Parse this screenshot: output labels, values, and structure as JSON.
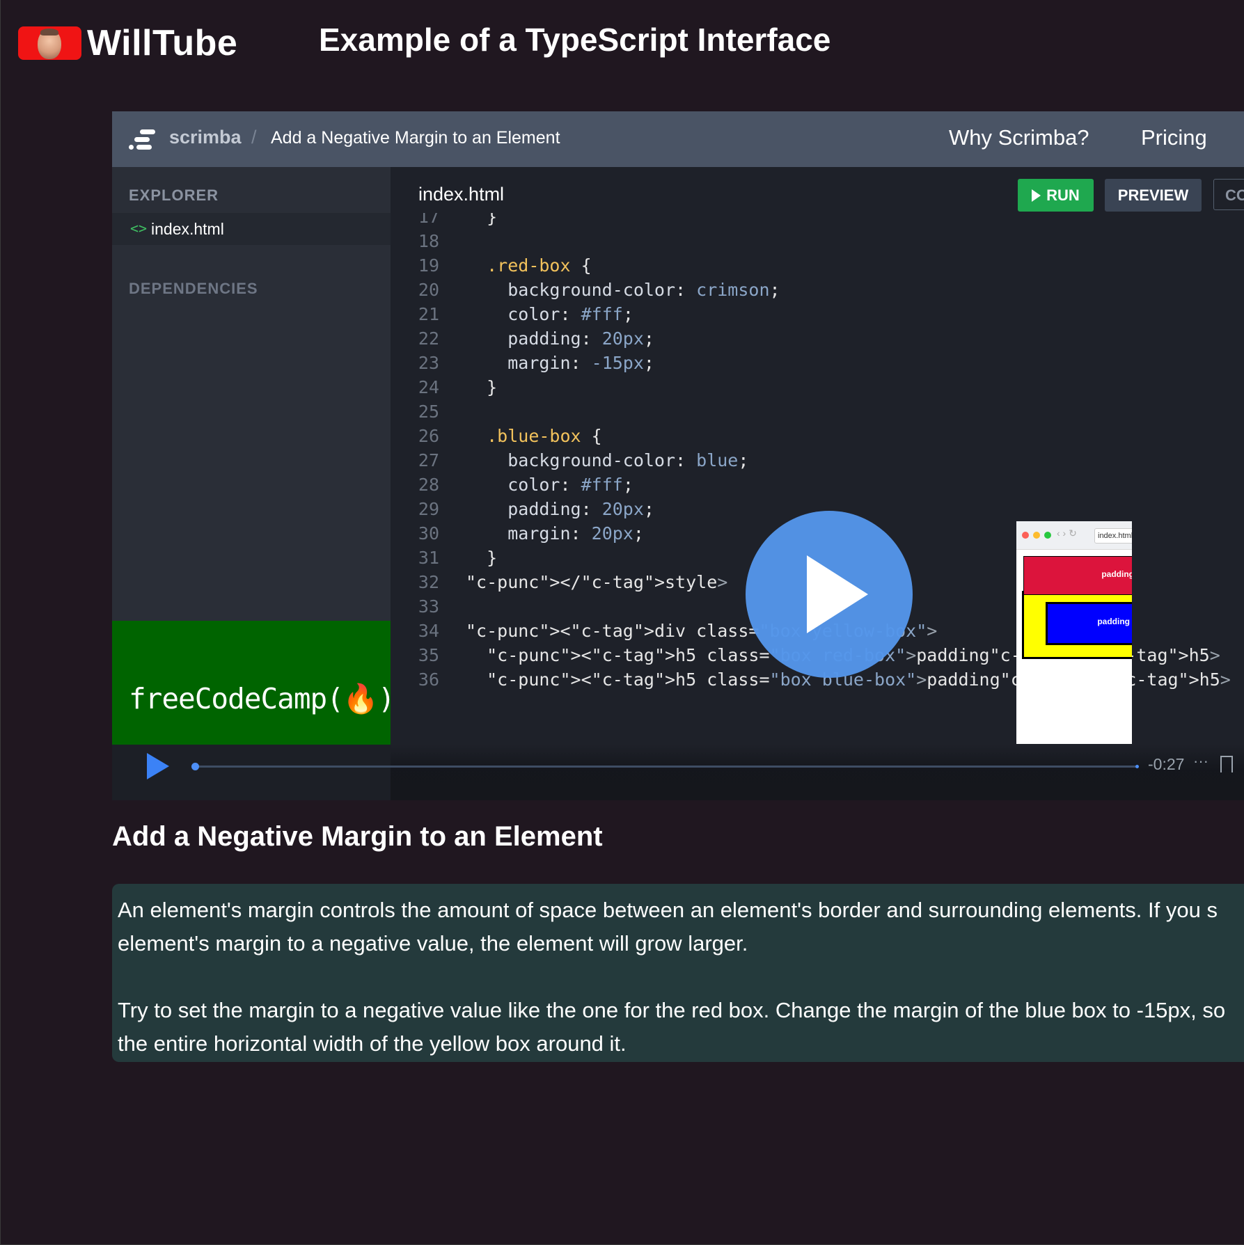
{
  "site": {
    "logo_text": "WillTube",
    "page_title": "Example of a TypeScript Interface"
  },
  "player": {
    "scrimba": {
      "brand": "scrimba",
      "separator": "/",
      "lesson": "Add a Negative Margin to an Element",
      "nav": [
        "Why Scrimba?",
        "Pricing"
      ]
    },
    "explorer": {
      "header": "EXPLORER",
      "file": "index.html",
      "dependencies_header": "DEPENDENCIES",
      "sponsor": "freeCodeCamp(🔥)"
    },
    "editor": {
      "tab": "index.html",
      "buttons": {
        "run": "RUN",
        "preview": "PREVIEW",
        "console": "CO"
      },
      "lines": [
        {
          "n": "17",
          "t": "  }"
        },
        {
          "n": "18",
          "t": ""
        },
        {
          "n": "19",
          "t": "  .red-box {"
        },
        {
          "n": "20",
          "t": "    background-color: crimson;"
        },
        {
          "n": "21",
          "t": "    color: #fff;"
        },
        {
          "n": "22",
          "t": "    padding: 20px;"
        },
        {
          "n": "23",
          "t": "    margin: -15px;"
        },
        {
          "n": "24",
          "t": "  }"
        },
        {
          "n": "25",
          "t": ""
        },
        {
          "n": "26",
          "t": "  .blue-box {"
        },
        {
          "n": "27",
          "t": "    background-color: blue;"
        },
        {
          "n": "28",
          "t": "    color: #fff;"
        },
        {
          "n": "29",
          "t": "    padding: 20px;"
        },
        {
          "n": "30",
          "t": "    margin: 20px;"
        },
        {
          "n": "31",
          "t": "  }"
        },
        {
          "n": "32",
          "t": "</style>"
        },
        {
          "n": "33",
          "t": ""
        },
        {
          "n": "34",
          "t": "<div class=\"box yellow-box\">"
        },
        {
          "n": "35",
          "t": "  <h5 class=\"box red-box\">padding</h5>"
        },
        {
          "n": "36",
          "t": "  <h5 class=\"box blue-box\">padding</h5>"
        }
      ]
    },
    "preview": {
      "url": "index.html",
      "red_label": "padding",
      "blue_label": "padding"
    },
    "controls": {
      "time": "-0:27",
      "more": "···",
      "progress": 0.0
    }
  },
  "lesson": {
    "title": "Add a Negative Margin to an Element",
    "paragraphs": [
      "An element's margin controls the amount of space between an element's border and surrounding elements. If you s",
      "element's margin to a negative value, the element will grow larger.",
      "Try to set the margin to a negative value like the one for the red box. Change the margin of the blue box to -15px, so",
      "the entire horizontal width of the yellow box around it."
    ]
  },
  "colors": {
    "background": "#201720",
    "logo_red": "#f01414",
    "scrimba_header": "#4a5465",
    "run_green": "#1fa84f",
    "fcc_green": "#006400",
    "play_blue": "#5496eb",
    "desc_bg": "#243a3c"
  }
}
